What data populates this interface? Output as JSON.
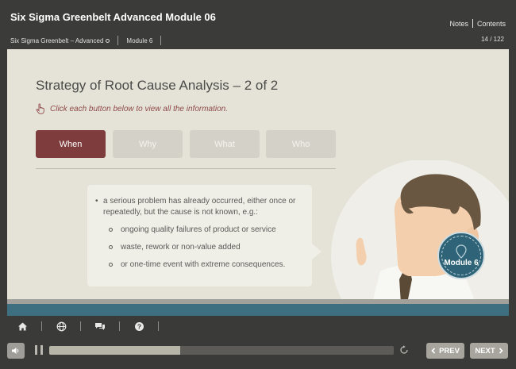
{
  "header": {
    "course_title": "Six Sigma Greenbelt Advanced Module 06",
    "notes_label": "Notes",
    "contents_label": "Contents",
    "breadcrumb_course": "Six Sigma Greenbelt – Advanced",
    "breadcrumb_module": "Module 6",
    "page_count": "14 / 122"
  },
  "slide": {
    "title": "Strategy of Root Cause Analysis – 2 of 2",
    "instruction": "Click each button below to view all the information.",
    "tabs": [
      {
        "label": "When",
        "active": true
      },
      {
        "label": "Why",
        "active": false
      },
      {
        "label": "What",
        "active": false
      },
      {
        "label": "Who",
        "active": false
      }
    ],
    "content": {
      "main_bullet": "a serious problem has already occurred, either once or repeatedly, but the cause is not known, e.g.:",
      "sub_items": [
        "ongoing quality failures of product or service",
        "waste, rework or non-value added",
        "or one-time event with extreme consequences."
      ]
    },
    "module_badge": "Module 6"
  },
  "toolbar": {
    "icons": [
      "home-icon",
      "globe-icon",
      "chat-icon",
      "help-icon"
    ]
  },
  "player": {
    "progress_fraction": 0.38,
    "prev_label": "PREV",
    "next_label": "NEXT"
  },
  "colors": {
    "accent": "#7f3c3c",
    "slide_bg": "#e5e3d7",
    "chrome_bg": "#3a3a38",
    "teal": "#3d6f80"
  }
}
